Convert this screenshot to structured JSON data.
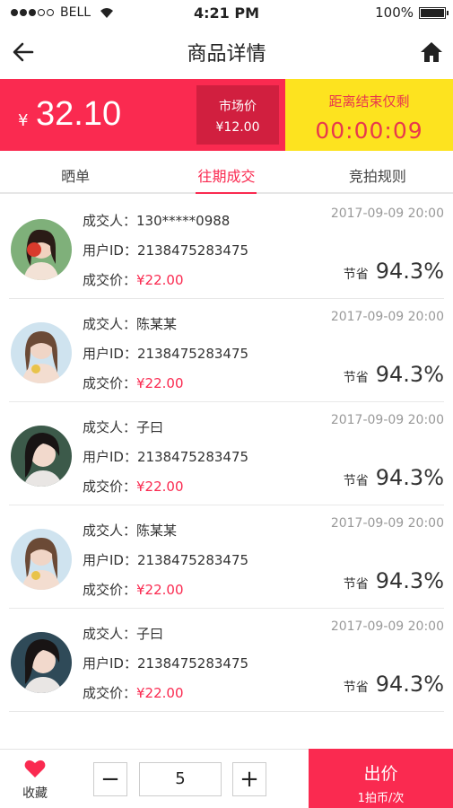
{
  "status": {
    "carrier": "BELL",
    "time": "4:21 PM",
    "battery": "100%",
    "battery_level": 1.0
  },
  "nav": {
    "title": "商品详情",
    "back_icon": "arrow-left-icon",
    "home_icon": "home-icon"
  },
  "price": {
    "currency": "¥",
    "current": "32.10",
    "market_label": "市场价",
    "market_price": "¥12.00",
    "countdown_label": "距离结束仅剩",
    "countdown": "00:00:09"
  },
  "tabs": [
    {
      "label": "晒单",
      "active": false
    },
    {
      "label": "往期成交",
      "active": true
    },
    {
      "label": "竞拍规则",
      "active": false
    }
  ],
  "records": [
    {
      "buyer_label": "成交人：",
      "buyer": "130*****0988",
      "uid_label": "用户ID：",
      "uid": "2138475283475",
      "price_label": "成交价：",
      "price": "¥22.00",
      "time": "2017-09-09 20:00",
      "save_label": "节省",
      "save": "94.3%"
    },
    {
      "buyer_label": "成交人：",
      "buyer": "陈某某",
      "uid_label": "用户ID：",
      "uid": "2138475283475",
      "price_label": "成交价：",
      "price": "¥22.00",
      "time": "2017-09-09 20:00",
      "save_label": "节省",
      "save": "94.3%"
    },
    {
      "buyer_label": "成交人：",
      "buyer": "子曰",
      "uid_label": "用户ID：",
      "uid": "2138475283475",
      "price_label": "成交价：",
      "price": "¥22.00",
      "time": "2017-09-09 20:00",
      "save_label": "节省",
      "save": "94.3%"
    },
    {
      "buyer_label": "成交人：",
      "buyer": "陈某某",
      "uid_label": "用户ID：",
      "uid": "2138475283475",
      "price_label": "成交价：",
      "price": "¥22.00",
      "time": "2017-09-09 20:00",
      "save_label": "节省",
      "save": "94.3%"
    },
    {
      "buyer_label": "成交人：",
      "buyer": "子曰",
      "uid_label": "用户ID：",
      "uid": "2138475283475",
      "price_label": "成交价：",
      "price": "¥22.00",
      "time": "2017-09-09 20:00",
      "save_label": "节省",
      "save": "94.3%"
    }
  ],
  "bottom": {
    "fav_label": "收藏",
    "fav_icon": "heart-icon",
    "minus": "−",
    "plus": "+",
    "quantity": "5",
    "bid_label": "出价",
    "bid_sub": "1拍币/次"
  },
  "colors": {
    "accent": "#fa2a50",
    "market_bg": "#d11f3f",
    "countdown_bg": "#fde31f"
  }
}
